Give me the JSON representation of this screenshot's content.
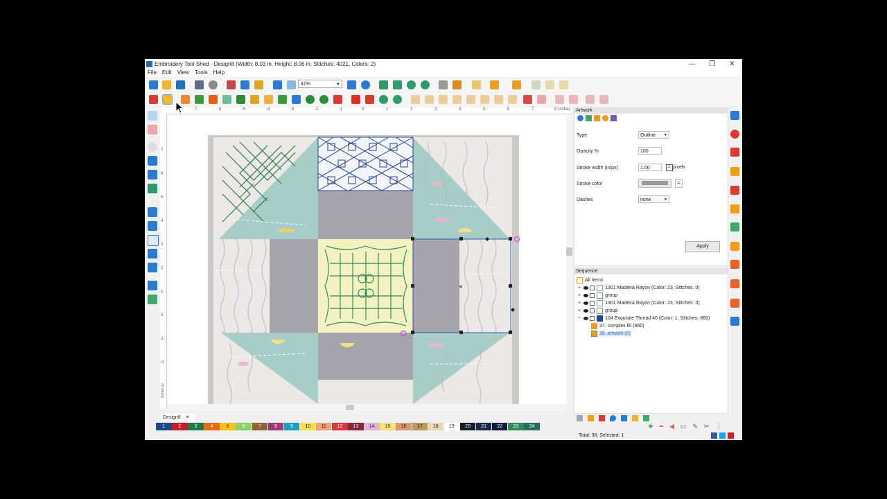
{
  "window": {
    "title": "Embroidery Tool Shed - Design8 (Width: 8.03 in, Height: 8.06 in, Stitches: 4021, Colors: 2)",
    "minimize": "—",
    "maximize": "❐",
    "close": "✕"
  },
  "menu": [
    "File",
    "Edit",
    "View",
    "Tools",
    "Help"
  ],
  "toolbar": {
    "zoom": "41%"
  },
  "ruler": {
    "top_ticks": [
      "-7",
      "-6",
      "-5",
      "-4",
      "-3",
      "-2",
      "-1",
      "0",
      "1",
      "2",
      "3",
      "4",
      "5",
      "6",
      "7",
      "8"
    ],
    "unit": "inches",
    "left_ticks": [
      "7",
      "6",
      "5",
      "4",
      "3",
      "2",
      "1",
      "0",
      "-1",
      "-2",
      "-3"
    ],
    "left_unit": "inches"
  },
  "artwork_panel": {
    "title": "Artwork",
    "type_label": "Type",
    "type_value": "Outline",
    "opacity_label": "Opacity %",
    "opacity_value": "100",
    "stroke_width_label": "Stroke width (in/px)",
    "stroke_width_value": "1.00",
    "pixels_label": "pixels",
    "stroke_color_label": "Stroke color",
    "stroke_color_eq": "=",
    "dashes_label": "Dashes",
    "dashes_value": "none",
    "apply": "Apply"
  },
  "sequence_panel": {
    "title": "Sequence",
    "root": "All items",
    "rows": [
      "1301 Madeira Rayon (Color: 23, Stitches: 0)",
      "group",
      "1301 Madeira Rayon (Color: 23, Stitches: 0)",
      "group",
      "104 Exquisite Thread 40 (Color: 1, Stitches: 860)",
      "37. complex fill (860)",
      "38. artwork (0)"
    ]
  },
  "tab": {
    "label": "Design8",
    "close": "✕"
  },
  "palette": [
    {
      "n": "1",
      "c": "#1e4a8c",
      "fg": "#fff"
    },
    {
      "n": "2",
      "c": "#c0202a",
      "fg": "#fff"
    },
    {
      "n": "3",
      "c": "#1f7a4a",
      "fg": "#fff"
    },
    {
      "n": "4",
      "c": "#e36d1b",
      "fg": "#fff"
    },
    {
      "n": "5",
      "c": "#f5c21b",
      "fg": "#222"
    },
    {
      "n": "6",
      "c": "#8fd06a",
      "fg": "#fff"
    },
    {
      "n": "7",
      "c": "#8c6239",
      "fg": "#fff"
    },
    {
      "n": "8",
      "c": "#9a3a78",
      "fg": "#fff"
    },
    {
      "n": "9",
      "c": "#1a9ec0",
      "fg": "#fff"
    },
    {
      "n": "10",
      "c": "#f5e04a",
      "fg": "#222"
    },
    {
      "n": "11",
      "c": "#f2a27a",
      "fg": "#222"
    },
    {
      "n": "12",
      "c": "#d8383e",
      "fg": "#fff"
    },
    {
      "n": "13",
      "c": "#7a2a3a",
      "fg": "#fff"
    },
    {
      "n": "14",
      "c": "#e4b4d8",
      "fg": "#222"
    },
    {
      "n": "15",
      "c": "#f3e27c",
      "fg": "#222"
    },
    {
      "n": "16",
      "c": "#d89a6e",
      "fg": "#222"
    },
    {
      "n": "17",
      "c": "#b79a5a",
      "fg": "#222"
    },
    {
      "n": "18",
      "c": "#e8d8b8",
      "fg": "#222"
    },
    {
      "n": "19",
      "c": "#ffffff",
      "fg": "#222"
    },
    {
      "n": "20",
      "c": "#1a1a2a",
      "fg": "#fff"
    },
    {
      "n": "21",
      "c": "#1c2a4a",
      "fg": "#fff"
    },
    {
      "n": "22",
      "c": "#0e1e3a",
      "fg": "#fff"
    },
    {
      "n": "23",
      "c": "#2f8a5a",
      "fg": "#fff"
    },
    {
      "n": "24",
      "c": "#2b6a5a",
      "fg": "#fff"
    }
  ],
  "status": {
    "text": "Total: 38, Selected: 1"
  },
  "icons": {
    "colors": {
      "blue": "#2a7ad3",
      "orange": "#f29d1a",
      "red": "#d93a34",
      "green": "#2e8b3e",
      "selection_handle": "#222",
      "rotate_handle": "#e040e0"
    }
  }
}
